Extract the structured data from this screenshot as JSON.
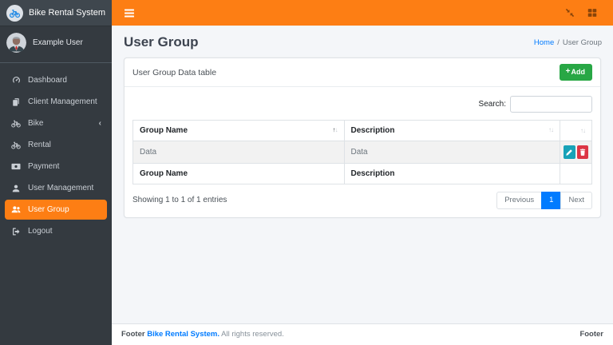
{
  "colors": {
    "accent_orange": "#fd7e14",
    "sidebar_bg": "#343a40",
    "page_bg": "#f4f6f9",
    "add_green": "#28a745",
    "edit_teal": "#17a2b8",
    "delete_red": "#dc3545",
    "link_blue": "#007bff"
  },
  "sidebar": {
    "brand": "Bike Rental System",
    "user_name": "Example User",
    "items": [
      {
        "label": "Dashboard",
        "icon": "dashboard-icon"
      },
      {
        "label": "Client Management",
        "icon": "copy-icon"
      },
      {
        "label": "Bike",
        "icon": "bike-icon",
        "chevron": "‹"
      },
      {
        "label": "Rental",
        "icon": "bike-icon"
      },
      {
        "label": "Payment",
        "icon": "banknote-icon"
      },
      {
        "label": "User Management",
        "icon": "user-icon"
      },
      {
        "label": "User Group",
        "icon": "users-icon",
        "active": true
      },
      {
        "label": "Logout",
        "icon": "logout-icon"
      }
    ]
  },
  "page": {
    "title": "User Group",
    "breadcrumb_home": "Home",
    "breadcrumb_separator": "/",
    "breadcrumb_current": "User Group"
  },
  "card": {
    "title": "User Group Data table",
    "add_icon": "+",
    "add_label": "Add",
    "search_label": "Search:",
    "search_value": "",
    "table": {
      "col_group_name": "Group Name",
      "col_description": "Description",
      "sort_up": "↑",
      "sort_down": "↓",
      "row": {
        "group_name": "Data",
        "description": "Data"
      },
      "foot_group_name": "Group Name",
      "foot_description": "Description"
    },
    "info": "Showing 1 to 1 of 1 entries",
    "pagination": {
      "previous": "Previous",
      "page": "1",
      "next": "Next"
    }
  },
  "footer": {
    "label": "Footer",
    "brand": "Bike Rental System.",
    "rights": "All rights reserved.",
    "right_label": "Footer"
  }
}
